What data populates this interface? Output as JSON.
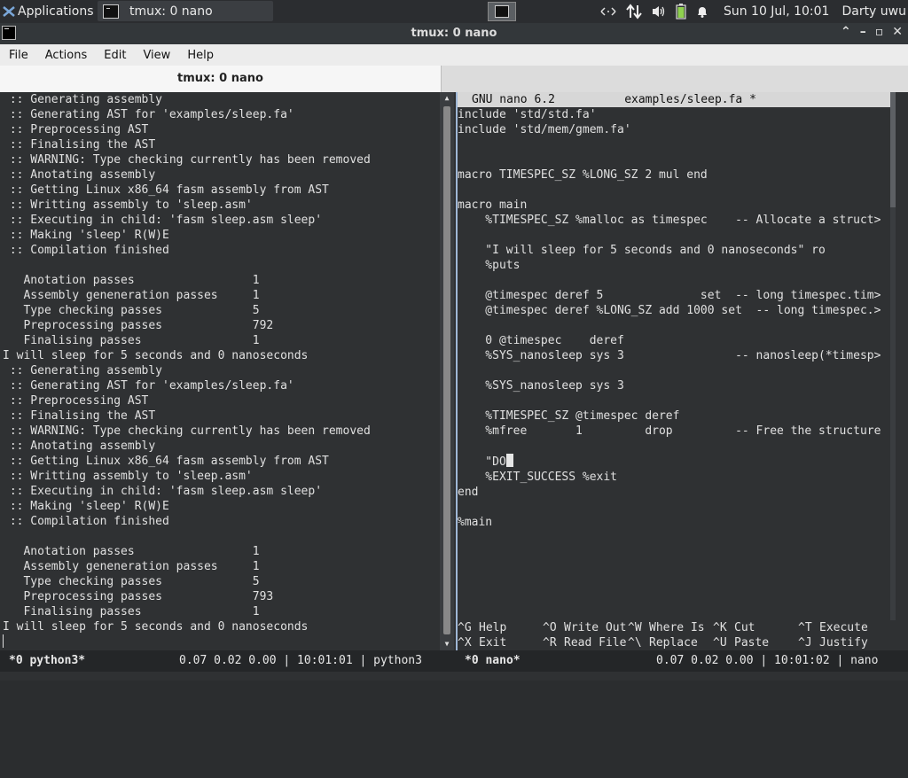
{
  "panel": {
    "apps_label": "Applications",
    "task_label": "tmux: 0 nano",
    "clock": "Sun 10 Jul, 10:01",
    "user": "Darty uwu"
  },
  "window": {
    "title": "tmux: 0 nano",
    "menu": [
      "File",
      "Actions",
      "Edit",
      "View",
      "Help"
    ],
    "tab_label": "tmux: 0 nano"
  },
  "left_pane": {
    "lines": [
      " :: Generating assembly",
      " :: Generating AST for 'examples/sleep.fa'",
      " :: Preprocessing AST",
      " :: Finalising the AST",
      " :: WARNING: Type checking currently has been removed",
      " :: Anotating assembly",
      " :: Getting Linux x86_64 fasm assembly from AST",
      " :: Writting assembly to 'sleep.asm'",
      " :: Executing in child: 'fasm sleep.asm sleep'",
      " :: Making 'sleep' R(W)E",
      " :: Compilation finished",
      "",
      "   Anotation passes                 1",
      "   Assembly geneneration passes     1",
      "   Type checking passes             5",
      "   Preprocessing passes             792",
      "   Finalising passes                1",
      "I will sleep for 5 seconds and 0 nanoseconds",
      " :: Generating assembly",
      " :: Generating AST for 'examples/sleep.fa'",
      " :: Preprocessing AST",
      " :: Finalising the AST",
      " :: WARNING: Type checking currently has been removed",
      " :: Anotating assembly",
      " :: Getting Linux x86_64 fasm assembly from AST",
      " :: Writting assembly to 'sleep.asm'",
      " :: Executing in child: 'fasm sleep.asm sleep'",
      " :: Making 'sleep' R(W)E",
      " :: Compilation finished",
      "",
      "   Anotation passes                 1",
      "   Assembly geneneration passes     1",
      "   Type checking passes             5",
      "   Preprocessing passes             793",
      "   Finalising passes                1",
      "I will sleep for 5 seconds and 0 nanoseconds"
    ]
  },
  "nano": {
    "title_left": "GNU nano 6.2",
    "title_file": "examples/sleep.fa *",
    "lines_before_cursor": [
      "include 'std/std.fa'",
      "include 'std/mem/gmem.fa'",
      "",
      "",
      "macro TIMESPEC_SZ %LONG_SZ 2 mul end",
      "",
      "macro main",
      "    %TIMESPEC_SZ %malloc as timespec    -- Allocate a struct>",
      "",
      "    \"I will sleep for 5 seconds and 0 nanoseconds\" ro",
      "    %puts",
      "",
      "    @timespec deref 5              set  -- long timespec.tim>",
      "    @timespec deref %LONG_SZ add 1000 set  -- long timespec.>",
      "",
      "    0 @timespec    deref",
      "    %SYS_nanosleep sys 3                -- nanosleep(*timesp>",
      "",
      "    %SYS_nanosleep sys 3",
      "",
      "    %TIMESPEC_SZ @timespec deref",
      "    %mfree       1         drop         -- Free the structure",
      ""
    ],
    "cursor_line": "    \"DO",
    "lines_after_cursor": [
      "    %EXIT_SUCCESS %exit",
      "end",
      "",
      "%main"
    ],
    "help_row1": [
      {
        "key": "^G",
        "label": "Help"
      },
      {
        "key": "^O",
        "label": "Write Out"
      },
      {
        "key": "^W",
        "label": "Where Is"
      },
      {
        "key": "^K",
        "label": "Cut"
      },
      {
        "key": "^T",
        "label": "Execute"
      }
    ],
    "help_row2": [
      {
        "key": "^X",
        "label": "Exit"
      },
      {
        "key": "^R",
        "label": "Read File"
      },
      {
        "key": "^\\",
        "label": "Replace"
      },
      {
        "key": "^U",
        "label": "Paste"
      },
      {
        "key": "^J",
        "label": "Justify"
      }
    ]
  },
  "status": {
    "left_window": "*0 python3*",
    "left_info": "0.07 0.02 0.00 | 10:01:01 | python3",
    "right_window": "*0 nano*",
    "right_info": "0.07 0.02 0.00 | 10:01:02 | nano"
  }
}
